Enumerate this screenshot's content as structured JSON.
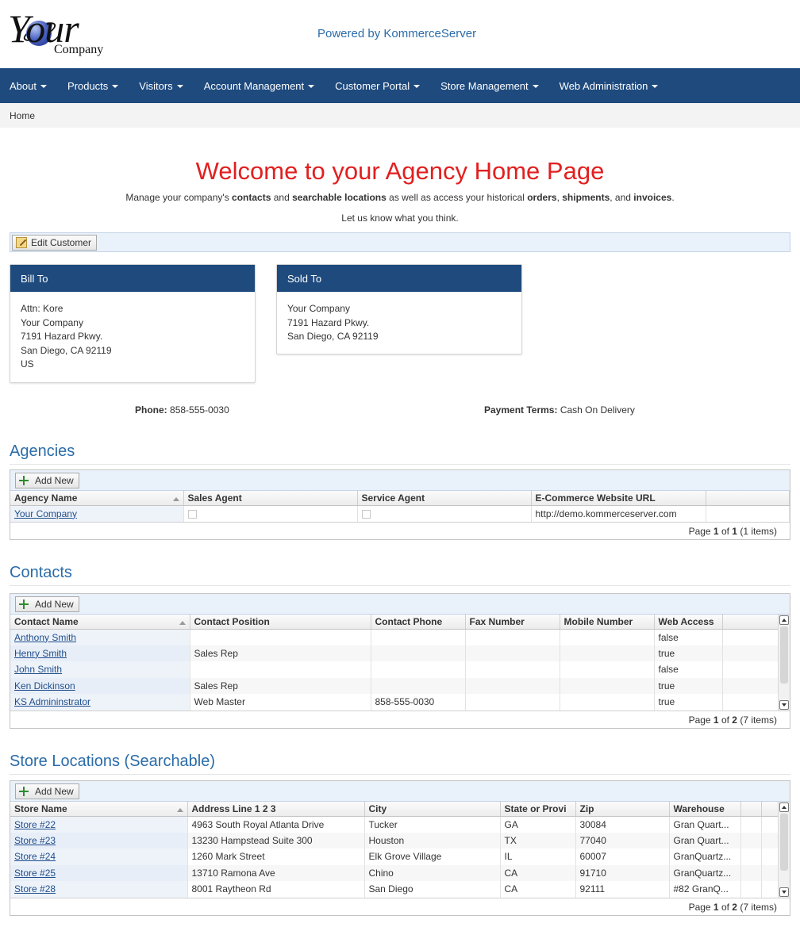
{
  "header": {
    "logo_main": "Your",
    "logo_sub": "Company",
    "powered_by": "Powered by KommerceServer"
  },
  "nav": {
    "items": [
      {
        "label": "About"
      },
      {
        "label": "Products"
      },
      {
        "label": "Visitors"
      },
      {
        "label": "Account Management"
      },
      {
        "label": "Customer Portal"
      },
      {
        "label": "Store Management"
      },
      {
        "label": "Web Administration"
      }
    ]
  },
  "breadcrumb": "Home",
  "welcome": {
    "title": "Welcome to your Agency Home Page",
    "text_1": "Manage your company's ",
    "bold_contacts": "contacts",
    "text_2": " and ",
    "bold_locations": "searchable locations",
    "text_3": " as well as access your historical ",
    "bold_orders": "orders",
    "text_4": ", ",
    "bold_shipments": "shipments",
    "text_5": ", and ",
    "bold_invoices": "invoices",
    "text_6": ".",
    "subtitle": "Let us know what you think."
  },
  "edit_customer_label": "Edit Customer",
  "bill_to": {
    "title": "Bill To",
    "lines": [
      "Attn: Kore",
      "Your Company",
      "7191 Hazard Pkwy.",
      "San Diego, CA 92119",
      "US"
    ]
  },
  "sold_to": {
    "title": "Sold To",
    "lines": [
      "Your Company",
      "7191 Hazard Pkwy.",
      "San Diego, CA 92119"
    ]
  },
  "phone": {
    "label": "Phone:",
    "value": "858-555-0030"
  },
  "payment_terms": {
    "label": "Payment Terms:",
    "value": "Cash On Delivery"
  },
  "add_new_label": "Add New",
  "agencies": {
    "title": "Agencies",
    "columns": [
      "Agency Name",
      "Sales Agent",
      "Service Agent",
      "E-Commerce Website URL",
      ""
    ],
    "rows": [
      {
        "name": "Your Company",
        "sales_agent": false,
        "service_agent": false,
        "url": "http://demo.kommerceserver.com"
      }
    ],
    "footer": {
      "prefix": "Page ",
      "page": "1",
      "of": " of ",
      "total": "1",
      "items": " (1 items)"
    }
  },
  "contacts": {
    "title": "Contacts",
    "columns": [
      "Contact Name",
      "Contact Position",
      "Contact Phone",
      "Fax Number",
      "Mobile Number",
      "Web Access",
      ""
    ],
    "rows": [
      {
        "name": "Anthony Smith",
        "position": "",
        "phone": "",
        "fax": "",
        "mobile": "",
        "web": "false"
      },
      {
        "name": "Henry Smith",
        "position": "Sales Rep",
        "phone": "",
        "fax": "",
        "mobile": "",
        "web": "true"
      },
      {
        "name": "John Smith",
        "position": "",
        "phone": "",
        "fax": "",
        "mobile": "",
        "web": "false"
      },
      {
        "name": "Ken Dickinson",
        "position": "Sales Rep",
        "phone": "",
        "fax": "",
        "mobile": "",
        "web": "true"
      },
      {
        "name": "KS Admininstrator",
        "position": "Web Master",
        "phone": "858-555-0030",
        "fax": "",
        "mobile": "",
        "web": "true"
      }
    ],
    "footer": {
      "prefix": "Page ",
      "page": "1",
      "of": " of ",
      "total": "2",
      "items": " (7 items)"
    }
  },
  "stores": {
    "title": "Store Locations (Searchable)",
    "columns": [
      "Store Name",
      "Address Line 1 2 3",
      "City",
      "State or Provi",
      "Zip",
      "Warehouse",
      "",
      ""
    ],
    "rows": [
      {
        "name": "Store #22",
        "address": "4963 South Royal Atlanta Drive",
        "city": "Tucker",
        "state": "GA",
        "zip": "30084",
        "warehouse": "Gran Quart..."
      },
      {
        "name": "Store #23",
        "address": "13230 Hampstead Suite 300",
        "city": "Houston",
        "state": "TX",
        "zip": "77040",
        "warehouse": "Gran Quart..."
      },
      {
        "name": "Store #24",
        "address": "1260 Mark Street",
        "city": "Elk Grove Village",
        "state": "IL",
        "zip": "60007",
        "warehouse": "GranQuartz..."
      },
      {
        "name": "Store #25",
        "address": "13710 Ramona Ave",
        "city": "Chino",
        "state": "CA",
        "zip": "91710",
        "warehouse": "GranQuartz..."
      },
      {
        "name": "Store #28",
        "address": "8001 Raytheon Rd",
        "city": "San Diego",
        "state": "CA",
        "zip": "92111",
        "warehouse": "#82 GranQ..."
      }
    ],
    "footer": {
      "prefix": "Page ",
      "page": "1",
      "of": " of ",
      "total": "2",
      "items": " (7 items)"
    }
  },
  "colors": {
    "nav_bg": "#1e4a7e",
    "title_red": "#e21f1f",
    "section_blue": "#2b6ca9"
  },
  "icons": [
    "caret-down-icon",
    "pencil-icon",
    "plus-icon",
    "sort-asc-icon",
    "scroll-up-icon",
    "scroll-down-icon"
  ]
}
